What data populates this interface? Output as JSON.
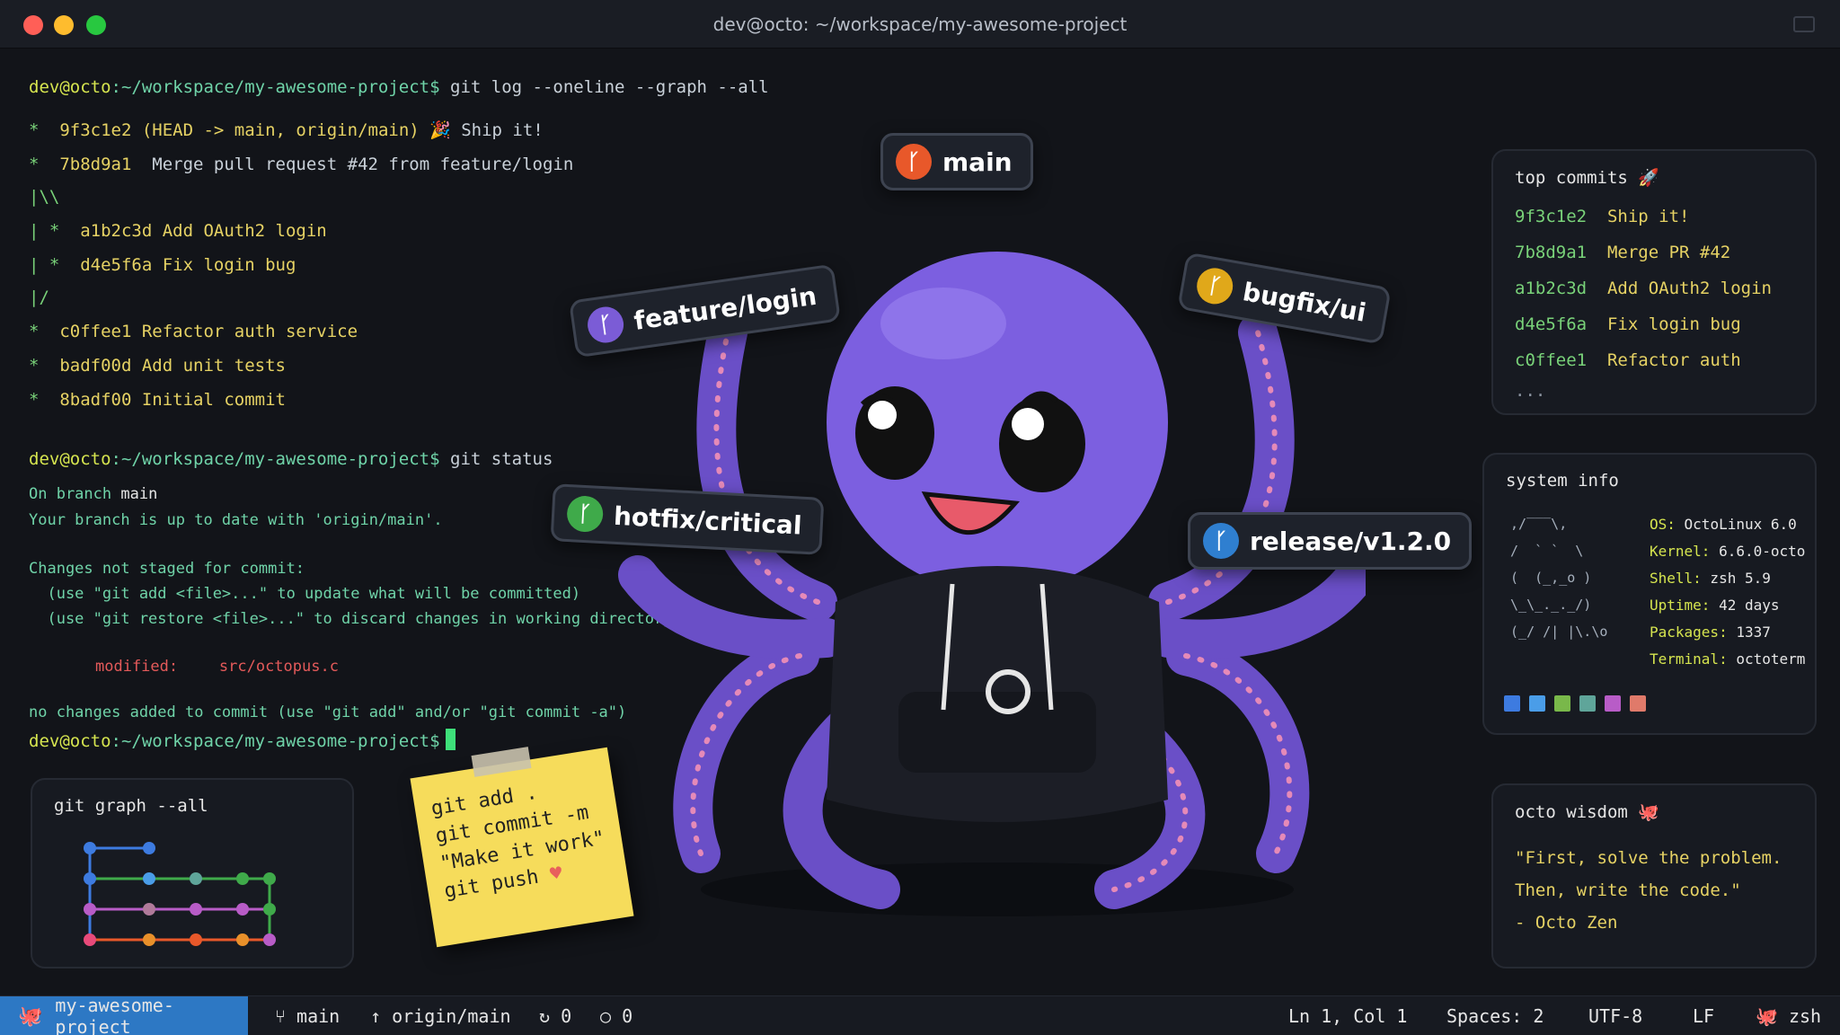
{
  "window": {
    "title": "dev@octo: ~/workspace/my-awesome-project"
  },
  "terminal": {
    "prompt_user": "dev@octo",
    "prompt_path": ":~/workspace/my-awesome-project$",
    "cmd1": "git log --oneline --graph --all",
    "log": [
      {
        "graph": "*  ",
        "hash": "9f3c1e2",
        "refs": " (HEAD -> main, origin/main)",
        "msg": " 🎉 Ship it!"
      },
      {
        "graph": "*  ",
        "hash": "7b8d9a1",
        "refs": "",
        "msg": "  Merge pull request #42 from feature/login"
      },
      {
        "graph": "|\\\\",
        "hash": "",
        "refs": "",
        "msg": ""
      },
      {
        "graph": "| * ",
        "hash": " a1b2c3d",
        "refs": "",
        "msg": " Add OAuth2 login"
      },
      {
        "graph": "| * ",
        "hash": " d4e5f6a",
        "refs": "",
        "msg": " Fix login bug"
      },
      {
        "graph": "|/",
        "hash": "",
        "refs": "",
        "msg": ""
      },
      {
        "graph": "*  ",
        "hash": "c0ffee1",
        "refs": "",
        "msg": " Refactor auth service"
      },
      {
        "graph": "*  ",
        "hash": "badf00d",
        "refs": "",
        "msg": " Add unit tests"
      },
      {
        "graph": "*  ",
        "hash": "8badf00",
        "refs": "",
        "msg": " Initial commit"
      }
    ],
    "cmd2": "git status",
    "status": {
      "on_branch_prefix": "On branch ",
      "on_branch_name": "main",
      "up_to_date": "Your branch is up to date with 'origin/main'.",
      "changes_header": "Changes not staged for commit:",
      "hint1": "  (use \"git add <file>...\" to update what will be committed)",
      "hint2": "  (use \"git restore <file>...\" to discard changes in working directory)",
      "modified_label": "modified:",
      "modified_file": "src/octopus.c",
      "no_changes": "no changes added to commit (use \"git add\" and/or \"git commit -a\")"
    }
  },
  "branches": {
    "main": "main",
    "feature": "feature/login",
    "bugfix": "bugfix/ui",
    "hotfix": "hotfix/critical",
    "release": "release/v1.2.0"
  },
  "sticky": {
    "lines": [
      "git add .",
      "git commit -m",
      "\"Make it work\"",
      "git push"
    ],
    "heart": "♥"
  },
  "graph_panel": {
    "title": "git graph --all"
  },
  "top_commits": {
    "title": "top commits 🚀",
    "rows": [
      {
        "hash": "9f3c1e2",
        "msg": "Ship it!"
      },
      {
        "hash": "7b8d9a1",
        "msg": "Merge PR #42"
      },
      {
        "hash": "a1b2c3d",
        "msg": "Add OAuth2 login"
      },
      {
        "hash": "d4e5f6a",
        "msg": "Fix login bug"
      },
      {
        "hash": "c0ffee1",
        "msg": "Refactor auth"
      }
    ],
    "more": "..."
  },
  "system_info": {
    "title": "system info",
    "ascii": [
      " ,/‾‾‾\\,",
      " /  ` `  \\",
      " (  (_,_o )",
      " \\_\\_._._/)",
      " (_/ /| |\\.\\o"
    ],
    "rows": [
      {
        "k": "OS:",
        "v": " OctoLinux 6.0"
      },
      {
        "k": "Kernel:",
        "v": " 6.6.0-octo"
      },
      {
        "k": "Shell:",
        "v": " zsh 5.9"
      },
      {
        "k": "Uptime:",
        "v": " 42 days"
      },
      {
        "k": "Packages:",
        "v": " 1337"
      },
      {
        "k": "Terminal:",
        "v": " octoterm"
      }
    ],
    "swatches": [
      "#3d7be0",
      "#4a9de8",
      "#79b84a",
      "#5fa59a",
      "#b85cc7",
      "#e07a6a"
    ]
  },
  "wisdom": {
    "title": "octo wisdom 🐙",
    "lines": [
      "\"First, solve the problem.",
      "Then, write the code.\"",
      "- Octo Zen"
    ]
  },
  "statusbar": {
    "project": "my-awesome-project",
    "branch": "main",
    "remote": "origin/main",
    "count1": "0",
    "count2": "0",
    "position": "Ln 1, Col 1",
    "spaces": "Spaces: 2",
    "encoding": "UTF-8",
    "eol": "LF",
    "shell": "zsh"
  },
  "colors": {
    "accent": "#2d78c4",
    "purple": "#7b5cd6",
    "yellow_badge": "#e0a81a",
    "orange_badge": "#e8582a",
    "green_badge": "#3faa4a",
    "blue_badge": "#2f7fd0"
  }
}
